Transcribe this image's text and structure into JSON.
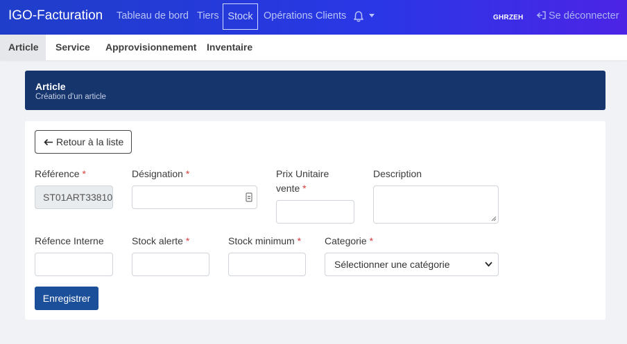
{
  "navbar": {
    "brand": "IGO-Facturation",
    "links": [
      "Tableau de bord",
      "Tiers",
      "Stock",
      "Opérations Clients"
    ],
    "active_link": "Stock",
    "user": "GHRZEH",
    "logout": "Se déconnecter",
    "icons": [
      "bell-icon",
      "caret-down-icon",
      "logout-icon"
    ]
  },
  "subnav": {
    "tabs": [
      "Article",
      "Service",
      "Approvisionnement",
      "Inventaire"
    ],
    "active": "Article"
  },
  "header": {
    "title": "Article",
    "subtitle": "Création d'un article"
  },
  "form": {
    "back_button": "Retour à la liste",
    "required_marker": "*",
    "fields": {
      "reference": {
        "label": "Référence",
        "value": "ST01ART33810",
        "required": true
      },
      "designation": {
        "label": "Désignation",
        "value": "",
        "required": true
      },
      "prix_unitaire": {
        "label_line1": "Prix Unitaire",
        "label_line2": "vente",
        "value": "",
        "required": true
      },
      "description": {
        "label": "Description",
        "value": "",
        "required": false
      },
      "reference_interne": {
        "label": "Réfence Interne",
        "value": "",
        "required": false
      },
      "stock_alerte": {
        "label": "Stock alerte",
        "value": "",
        "required": true
      },
      "stock_minimum": {
        "label": "Stock minimum",
        "value": "",
        "required": true
      },
      "categorie": {
        "label": "Categorie",
        "selected": "Sélectionner une catégorie",
        "required": true
      }
    },
    "save_button": "Enregistrer"
  },
  "colors": {
    "navbar_gradient_start": "#1f3ec9",
    "navbar_gradient_end": "#4c24e6",
    "header_bg": "#16356c",
    "primary_button": "#1c4f9a",
    "required_marker": "#e03b3b"
  }
}
